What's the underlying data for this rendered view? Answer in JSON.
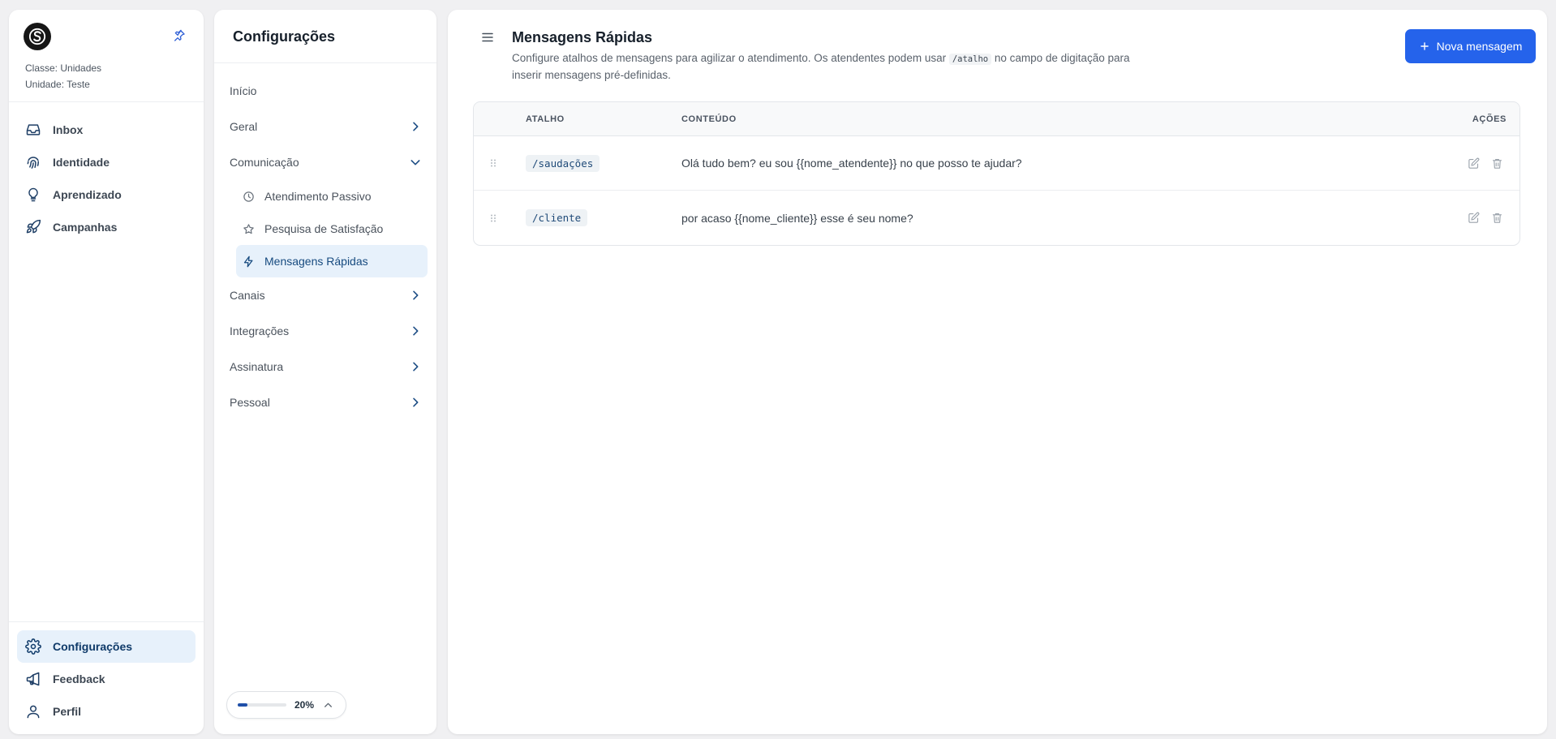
{
  "sidebar": {
    "org_class": "Classe: Unidades",
    "org_unit": "Unidade: Teste",
    "nav": [
      {
        "label": "Inbox",
        "icon": "inbox-icon"
      },
      {
        "label": "Identidade",
        "icon": "fingerprint-icon"
      },
      {
        "label": "Aprendizado",
        "icon": "lightbulb-icon"
      },
      {
        "label": "Campanhas",
        "icon": "rocket-icon"
      }
    ],
    "footer": [
      {
        "label": "Configurações",
        "icon": "gear-icon",
        "active": true
      },
      {
        "label": "Feedback",
        "icon": "megaphone-icon"
      },
      {
        "label": "Perfil",
        "icon": "user-icon"
      }
    ]
  },
  "settings": {
    "title": "Configurações",
    "items": {
      "inicio": "Início",
      "geral": "Geral",
      "comunicacao": "Comunicação",
      "sub_atendimento": "Atendimento Passivo",
      "sub_pesquisa": "Pesquisa de Satisfação",
      "sub_mensagens": "Mensagens Rápidas",
      "canais": "Canais",
      "integracoes": "Integrações",
      "assinatura": "Assinatura",
      "pessoal": "Pessoal"
    },
    "zoom": {
      "label": "20%",
      "value_pct": 20
    }
  },
  "main": {
    "title": "Mensagens Rápidas",
    "desc_before": "Configure atalhos de mensagens para agilizar o atendimento. Os atendentes podem usar ",
    "desc_code": "/atalho",
    "desc_after": " no campo de digitação para inserir mensagens pré-definidas.",
    "new_button": "Nova mensagem",
    "table": {
      "headers": {
        "atalho": "ATALHO",
        "conteudo": "CONTEÚDO",
        "acoes": "AÇÕES"
      },
      "rows": [
        {
          "atalho": "/saudações",
          "conteudo": "Olá tudo bem? eu sou {{nome_atendente}} no que posso te ajudar?"
        },
        {
          "atalho": "/cliente",
          "conteudo": "por acaso {{nome_cliente}} esse é seu nome?"
        }
      ]
    }
  },
  "colors": {
    "primary": "#2563eb",
    "active_bg": "#e7f1fb",
    "active_text": "#0f3a69"
  }
}
